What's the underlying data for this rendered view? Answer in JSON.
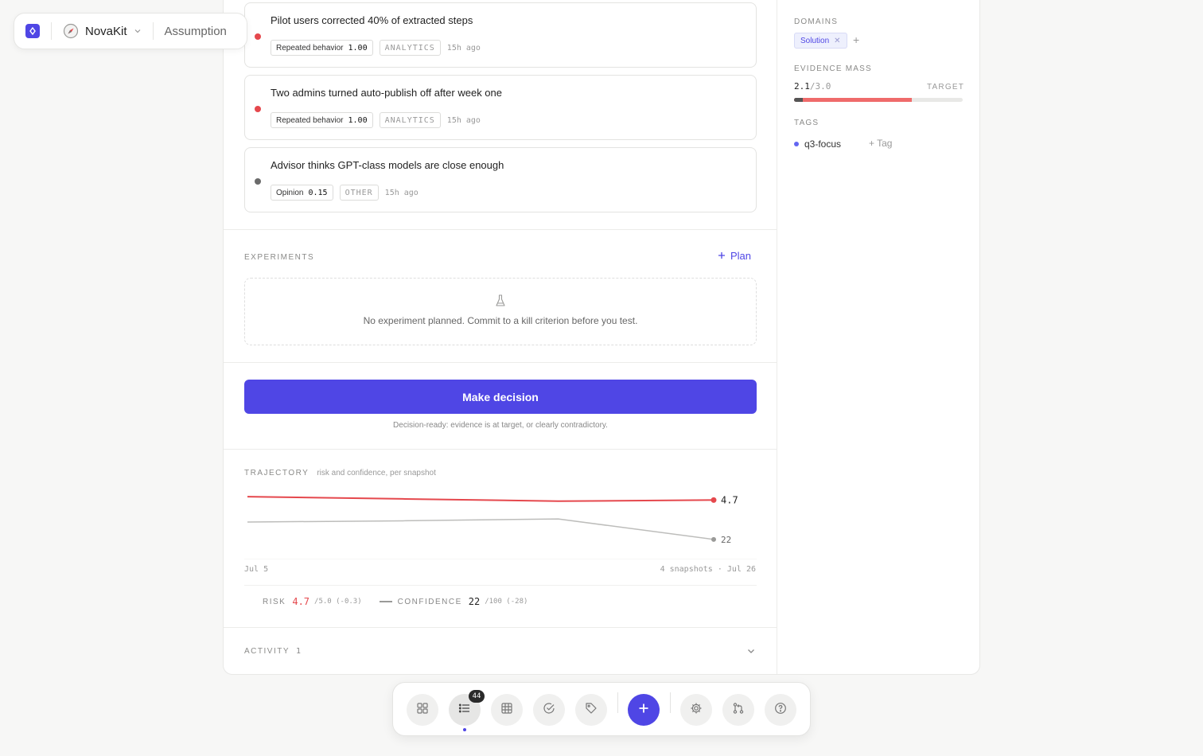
{
  "breadcrumb": {
    "project_name": "NovaKit",
    "entity_kind": "Assumption"
  },
  "evidence": [
    {
      "title": "Pilot users corrected 40% of extracted steps",
      "status_color": "#e5484d",
      "strength_label": "Repeated behavior",
      "strength_value": "1.00",
      "source": "ANALYTICS",
      "age": "15h ago"
    },
    {
      "title": "Two admins turned auto-publish off after week one",
      "status_color": "#e5484d",
      "strength_label": "Repeated behavior",
      "strength_value": "1.00",
      "source": "ANALYTICS",
      "age": "15h ago"
    },
    {
      "title": "Advisor thinks GPT-class models are close enough",
      "status_color": "#6b6b6b",
      "strength_label": "Opinion",
      "strength_value": "0.15",
      "source": "OTHER",
      "age": "15h ago"
    }
  ],
  "experiments": {
    "heading": "EXPERIMENTS",
    "plan_label": "Plan",
    "empty_message": "No experiment planned. Commit to a kill criterion before you test."
  },
  "decision": {
    "button_label": "Make decision",
    "note": "Decision-ready: evidence is at target, or clearly contradictory."
  },
  "trajectory": {
    "heading": "TRAJECTORY",
    "subheading": "risk and confidence, per snapshot",
    "start_label": "Jul 5",
    "end_label": "4 snapshots · Jul 26",
    "risk_end_label": "4.7",
    "confidence_end_label": "22",
    "legend": {
      "risk_label": "RISK",
      "risk_value": "4.7",
      "risk_detail": "/5.0 (-0.3)",
      "confidence_label": "CONFIDENCE",
      "confidence_value": "22",
      "confidence_detail": "/100 (-28)"
    }
  },
  "chart_data": {
    "type": "line",
    "x": [
      "Jul 5",
      "",
      "",
      "Jul 26"
    ],
    "series": [
      {
        "name": "RISK",
        "color": "#e5484d",
        "values": [
          5.0,
          4.8,
          4.6,
          4.7
        ],
        "ylim": [
          0,
          5.5
        ]
      },
      {
        "name": "CONFIDENCE",
        "color": "#bdbdbb",
        "values": [
          50,
          52,
          55,
          22
        ],
        "ylim": [
          0,
          100
        ]
      }
    ]
  },
  "activity": {
    "label": "ACTIVITY",
    "count": "1"
  },
  "sidebar": {
    "domains_label": "DOMAINS",
    "domains": [
      "Solution"
    ],
    "evidence_mass_label": "EVIDENCE MASS",
    "evidence_mass_value": "2.1",
    "evidence_mass_of": "/3.0",
    "target_label": "TARGET",
    "evidence_mass_fraction": 0.7,
    "tags_label": "TAGS",
    "tags": [
      "q3-focus"
    ],
    "add_tag_label": "Tag"
  },
  "dock": {
    "items": [
      "grid-icon",
      "list-icon",
      "table-icon",
      "check-icon",
      "tag-icon",
      "plus-icon",
      "settings-icon",
      "branch-icon",
      "help-icon"
    ],
    "list_badge": "44"
  },
  "colors": {
    "accent": "#4f46e5",
    "risk": "#e5484d",
    "confidence": "#bdbdbb"
  }
}
